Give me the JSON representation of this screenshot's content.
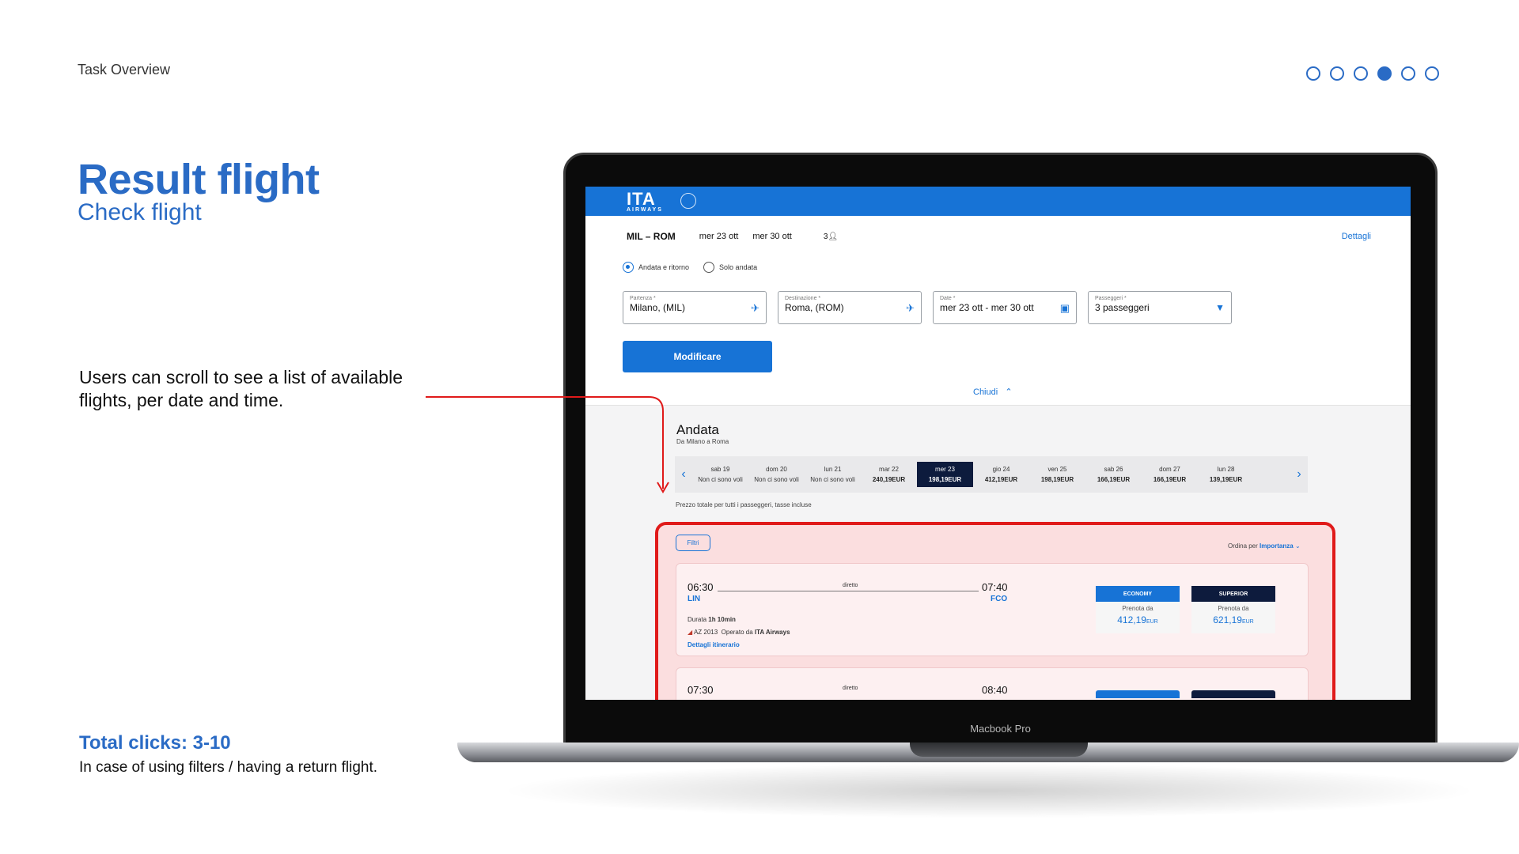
{
  "slide": {
    "section": "Task Overview",
    "title": "Result flight",
    "subtitle": "Check flight",
    "description": "Users can scroll to see a list of available flights, per date and time.",
    "clicks_title": "Total clicks: 3-10",
    "clicks_description": "In case of using filters / having  a return flight.",
    "device_label": "Macbook Pro",
    "progress": {
      "total": 6,
      "current": 4
    }
  },
  "app": {
    "logo": "ITA",
    "logo_sub": "AIRWAYS",
    "summary": {
      "route": "MIL – ROM",
      "date_out": "mer 23 ott",
      "date_return": "mer 30 ott",
      "pax_count": "3",
      "details_link": "Dettagli"
    },
    "trip_types": [
      "Andata e ritorno",
      "Solo andata"
    ],
    "fields": {
      "from": {
        "label": "Partenza *",
        "value": "Milano,  (MIL)"
      },
      "to": {
        "label": "Destinazione *",
        "value": "Roma,  (ROM)"
      },
      "dates": {
        "label": "Date *",
        "value": "mer 23 ott  -  mer 30 ott"
      },
      "passengers": {
        "label": "Passeggeri *",
        "value": "3 passeggeri"
      }
    },
    "modify_button": "Modificare",
    "close_link": "Chiudi",
    "outbound": {
      "title": "Andata",
      "subtitle": "Da Milano a Roma",
      "dates": [
        {
          "day": "sab 19",
          "price": "Non ci sono voli"
        },
        {
          "day": "dom 20",
          "price": "Non ci sono voli"
        },
        {
          "day": "lun 21",
          "price": "Non ci sono voli"
        },
        {
          "day": "mar 22",
          "price": "240,19EUR"
        },
        {
          "day": "mer 23",
          "price": "198,19EUR"
        },
        {
          "day": "gio 24",
          "price": "412,19EUR"
        },
        {
          "day": "ven 25",
          "price": "198,19EUR"
        },
        {
          "day": "sab 26",
          "price": "166,19EUR"
        },
        {
          "day": "dom 27",
          "price": "166,19EUR"
        },
        {
          "day": "lun 28",
          "price": "139,19EUR"
        }
      ],
      "selected_date_index": 4,
      "price_note": "Prezzo totale per tutti i passeggeri, tasse incluse",
      "filters_button": "Filtri",
      "sort_label": "Ordina per",
      "sort_value": "Importanza",
      "flights": [
        {
          "dep_time": "06:30",
          "dep_airport": "LIN",
          "arr_time": "07:40",
          "arr_airport": "FCO",
          "stops": "diretto",
          "duration_label": "Durata",
          "duration": "1h 10min",
          "flight_no": "AZ 2013",
          "operated_label": "Operato da",
          "operator": "ITA Airways",
          "details_link": "Dettagli itinerario",
          "economy": {
            "label": "ECONOMY",
            "from": "Prenota da",
            "price": "412,19",
            "currency": "EUR"
          },
          "superior": {
            "label": "SUPERIOR",
            "from": "Prenota da",
            "price": "621,19",
            "currency": "EUR"
          }
        },
        {
          "dep_time": "07:30",
          "arr_time": "08:40",
          "stops": "diretto"
        }
      ]
    }
  },
  "colors": {
    "accent": "#2a6bc5",
    "brand": "#1773d6",
    "navy": "#0d1b3d",
    "highlight": "#e01a1a"
  }
}
